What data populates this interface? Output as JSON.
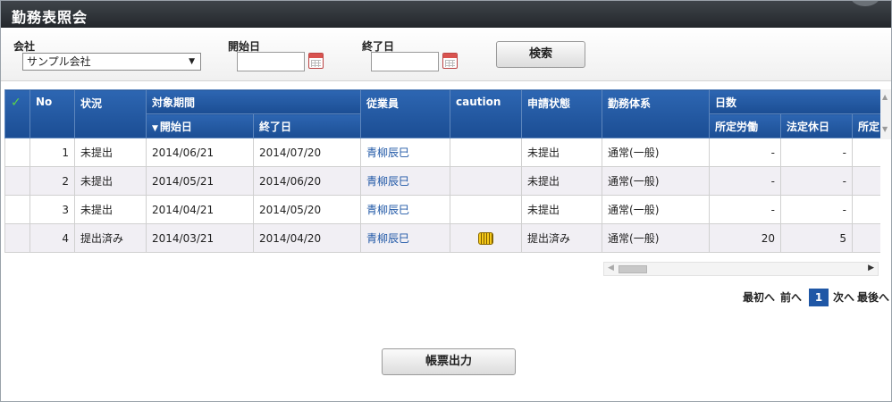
{
  "header": {
    "title": "勤務表照会"
  },
  "filters": {
    "company_label": "会社",
    "company_value": "サンプル会社",
    "start_label": "開始日",
    "start_value": "",
    "end_label": "終了日",
    "end_value": "",
    "search_label": "検索"
  },
  "grid": {
    "headers": {
      "no": "No",
      "status": "状況",
      "period": "対象期間",
      "period_start": "開始日",
      "period_end": "終了日",
      "employee": "従業員",
      "caution": "caution",
      "application": "申請状態",
      "system": "勤務体系",
      "days": "日数",
      "days_work": "所定労働",
      "days_holiday": "法定休日",
      "days_other": "所定"
    },
    "rows": [
      {
        "no": "1",
        "status": "未提出",
        "start": "2014/06/21",
        "end": "2014/07/20",
        "employee": "青柳辰巳",
        "caution": "",
        "app_status": "未提出",
        "system": "通常(一般)",
        "work": "-",
        "holiday": "-"
      },
      {
        "no": "2",
        "status": "未提出",
        "start": "2014/05/21",
        "end": "2014/06/20",
        "employee": "青柳辰巳",
        "caution": "",
        "app_status": "未提出",
        "system": "通常(一般)",
        "work": "-",
        "holiday": "-"
      },
      {
        "no": "3",
        "status": "未提出",
        "start": "2014/04/21",
        "end": "2014/05/20",
        "employee": "青柳辰巳",
        "caution": "",
        "app_status": "未提出",
        "system": "通常(一般)",
        "work": "-",
        "holiday": "-"
      },
      {
        "no": "4",
        "status": "提出済み",
        "start": "2014/03/21",
        "end": "2014/04/20",
        "employee": "青柳辰巳",
        "caution": "caution-icon",
        "app_status": "提出済み",
        "system": "通常(一般)",
        "work": "20",
        "holiday": "5"
      }
    ]
  },
  "pager": {
    "first": "最初へ",
    "prev": "前へ",
    "current": "1",
    "next": "次へ",
    "last": "最後へ"
  },
  "export_label": "帳票出力",
  "colors": {
    "header_bg": "#1f57a6",
    "titlebar_bg": "#2b2f33",
    "link": "#1f57a6",
    "check": "#5bd34a"
  }
}
